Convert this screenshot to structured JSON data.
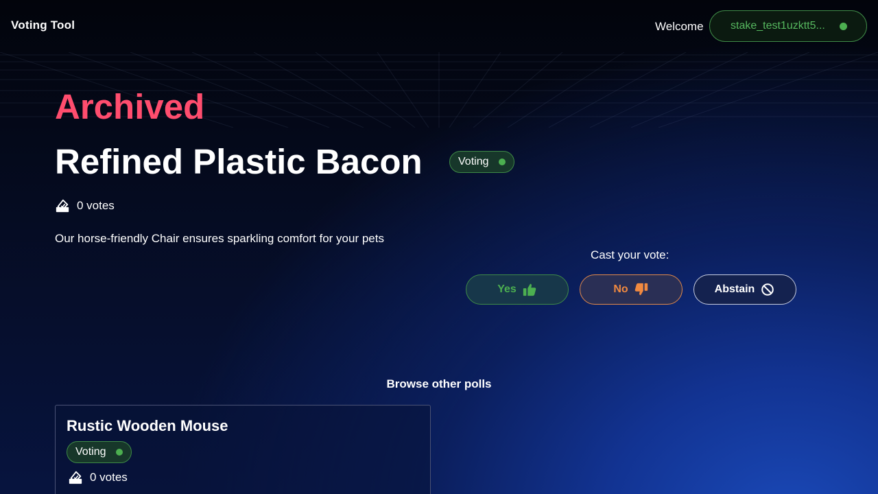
{
  "header": {
    "brand": "Voting Tool",
    "welcome": "Welcome",
    "wallet_address": "stake_test1uzktt5..."
  },
  "poll": {
    "status": "Archived",
    "title": "Refined Plastic Bacon",
    "phase_badge": "Voting",
    "votes_text": "0 votes",
    "description": "Our horse-friendly Chair ensures sparkling comfort for your pets"
  },
  "vote_panel": {
    "prompt": "Cast your vote:",
    "yes_label": "Yes",
    "no_label": "No",
    "abstain_label": "Abstain"
  },
  "browse": {
    "heading": "Browse other polls",
    "polls": [
      {
        "title": "Rustic Wooden Mouse",
        "phase_badge": "Voting",
        "votes_text": "0 votes"
      }
    ]
  },
  "icons": {
    "ballot": "ballot-icon",
    "yes": "thumbs-up-icon",
    "no": "thumbs-down-icon",
    "abstain": "ban-icon"
  },
  "colors": {
    "archived": "#ff4d6e",
    "active_green": "#4caf50",
    "no_orange": "#f28a40"
  }
}
